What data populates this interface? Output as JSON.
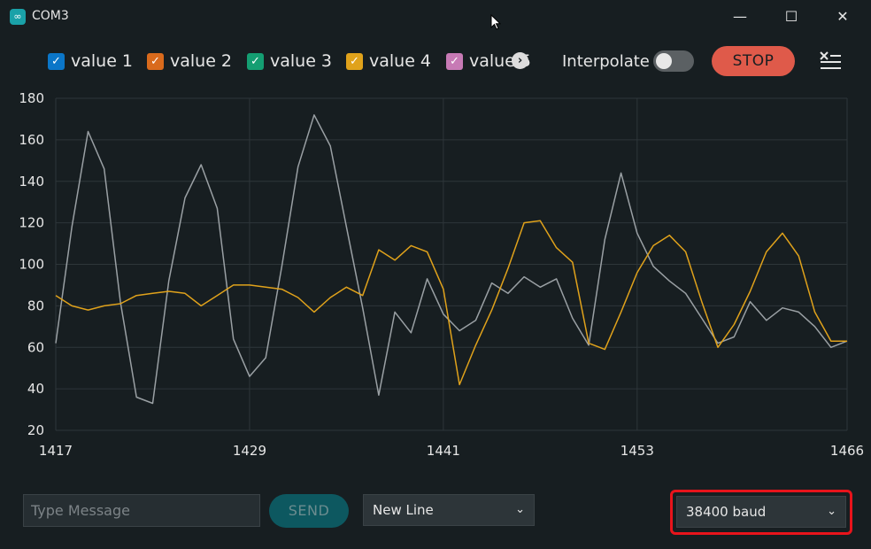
{
  "window": {
    "title": "COM3",
    "app_icon_glyph": "∞",
    "minimize_glyph": "—",
    "maximize_glyph": "☐",
    "close_glyph": "✕"
  },
  "legend": {
    "items": [
      {
        "label": "value 1",
        "color": "#0b76c8"
      },
      {
        "label": "value 2",
        "color": "#d96a1c"
      },
      {
        "label": "value 3",
        "color": "#149e72"
      },
      {
        "label": "value 4",
        "color": "#e0a21b"
      },
      {
        "label": "value 5",
        "color": "#c77ab5"
      }
    ],
    "check_glyph": "✓",
    "scroll_glyph": "›",
    "interpolate_label": "Interpolate",
    "interpolate_on": false,
    "stop_label": "STOP"
  },
  "chart_data": {
    "type": "line",
    "xlim": [
      1417,
      1466
    ],
    "ylim": [
      20,
      180
    ],
    "x_ticks": [
      1417,
      1429,
      1441,
      1453,
      1466
    ],
    "y_ticks": [
      20,
      40,
      60,
      80,
      100,
      120,
      140,
      160,
      180
    ],
    "grid": true,
    "x": [
      1417,
      1418,
      1419,
      1420,
      1421,
      1422,
      1423,
      1424,
      1425,
      1426,
      1427,
      1428,
      1429,
      1430,
      1431,
      1432,
      1433,
      1434,
      1435,
      1436,
      1437,
      1438,
      1439,
      1440,
      1441,
      1442,
      1443,
      1444,
      1445,
      1446,
      1447,
      1448,
      1449,
      1450,
      1451,
      1452,
      1453,
      1454,
      1455,
      1456,
      1457,
      1458,
      1459,
      1460,
      1461,
      1462,
      1463,
      1464,
      1465,
      1466
    ],
    "series": [
      {
        "color": "#9aa0a4",
        "values": [
          62,
          118,
          164,
          146,
          82,
          36,
          33,
          92,
          132,
          148,
          127,
          64,
          46,
          55,
          99,
          147,
          172,
          157,
          118,
          79,
          37,
          77,
          67,
          93,
          76,
          68,
          73,
          91,
          86,
          94,
          89,
          93,
          74,
          61,
          112,
          144,
          115,
          99,
          92,
          86,
          74,
          62,
          65,
          82,
          73,
          79,
          77,
          70,
          60,
          63
        ]
      },
      {
        "color": "#e0a21b",
        "values": [
          85,
          80,
          78,
          80,
          81,
          85,
          86,
          87,
          86,
          80,
          85,
          90,
          90,
          89,
          88,
          84,
          77,
          84,
          89,
          85,
          107,
          102,
          109,
          106,
          88,
          42,
          61,
          78,
          98,
          120,
          121,
          108,
          101,
          62,
          59,
          77,
          96,
          109,
          114,
          106,
          82,
          60,
          71,
          87,
          106,
          115,
          104,
          77,
          63,
          63
        ]
      }
    ]
  },
  "footer": {
    "message_placeholder": "Type Message",
    "send_label": "SEND",
    "line_ending": "New Line",
    "baud_rate": "38400 baud",
    "chevron_glyph": "⌄"
  }
}
